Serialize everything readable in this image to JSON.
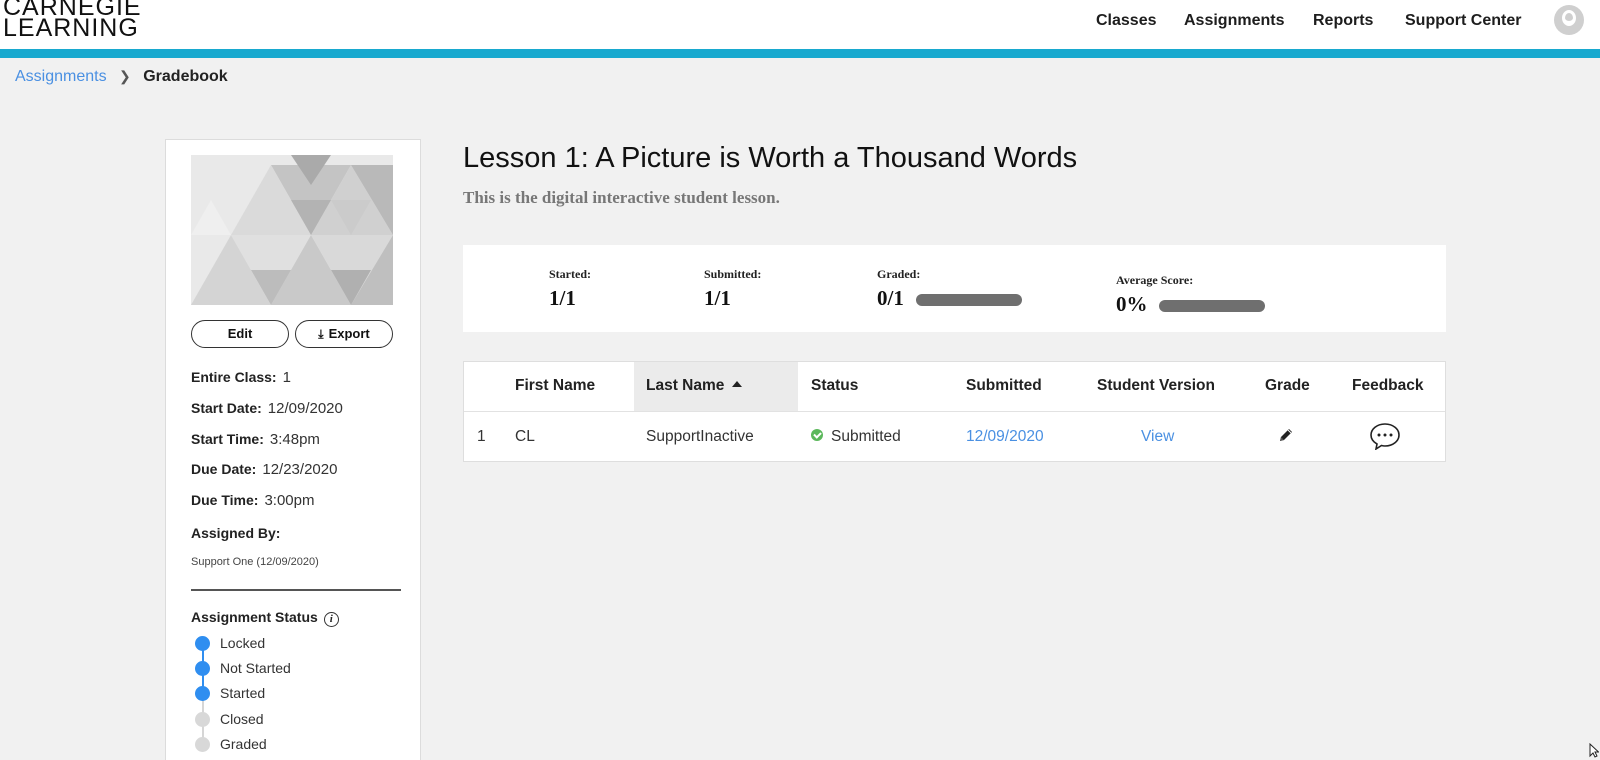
{
  "brand": {
    "line1": "CARNEGIE",
    "line2": "LEARNING"
  },
  "nav": {
    "items": [
      "Classes",
      "Assignments",
      "Reports",
      "Support Center"
    ]
  },
  "breadcrumb": {
    "parent": "Assignments",
    "current": "Gradebook"
  },
  "sidebar": {
    "edit_label": "Edit",
    "export_label": "Export",
    "entire_class_label": "Entire Class:",
    "entire_class_value": "1",
    "start_date_label": "Start Date:",
    "start_date_value": "12/09/2020",
    "start_time_label": "Start Time:",
    "start_time_value": "3:48pm",
    "due_date_label": "Due Date:",
    "due_date_value": "12/23/2020",
    "due_time_label": "Due Time:",
    "due_time_value": "3:00pm",
    "assigned_by_label": "Assigned By:",
    "assigned_by_value": "Support One (12/09/2020)",
    "status_title": "Assignment Status",
    "statuses": [
      {
        "label": "Locked",
        "active": true
      },
      {
        "label": "Not Started",
        "active": true
      },
      {
        "label": "Started",
        "active": true
      },
      {
        "label": "Closed",
        "active": false
      },
      {
        "label": "Graded",
        "active": false
      }
    ]
  },
  "lesson": {
    "title": "Lesson 1: A Picture is Worth a Thousand Words",
    "subtitle": "This is the digital interactive student lesson."
  },
  "stats": {
    "started_label": "Started:",
    "started_value": "1/1",
    "submitted_label": "Submitted:",
    "submitted_value": "1/1",
    "graded_label": "Graded:",
    "graded_value": "0/1",
    "graded_progress": 0,
    "average_label": "Average Score:",
    "average_value": "0%",
    "average_progress": 0
  },
  "table": {
    "columns": [
      "First Name",
      "Last Name",
      "Status",
      "Submitted",
      "Student Version",
      "Grade",
      "Feedback"
    ],
    "sorted_column": "Last Name",
    "sort_direction": "ascending",
    "rows": [
      {
        "index": "1",
        "first_name": "CL",
        "last_name": "SupportInactive",
        "status": "Submitted",
        "submitted": "12/09/2020",
        "student_version": "View"
      }
    ]
  },
  "colors": {
    "accent": "#18a9cf",
    "link": "#4a90e2",
    "status_on": "#2f8ef0",
    "submitted_check": "#5cb85c"
  }
}
